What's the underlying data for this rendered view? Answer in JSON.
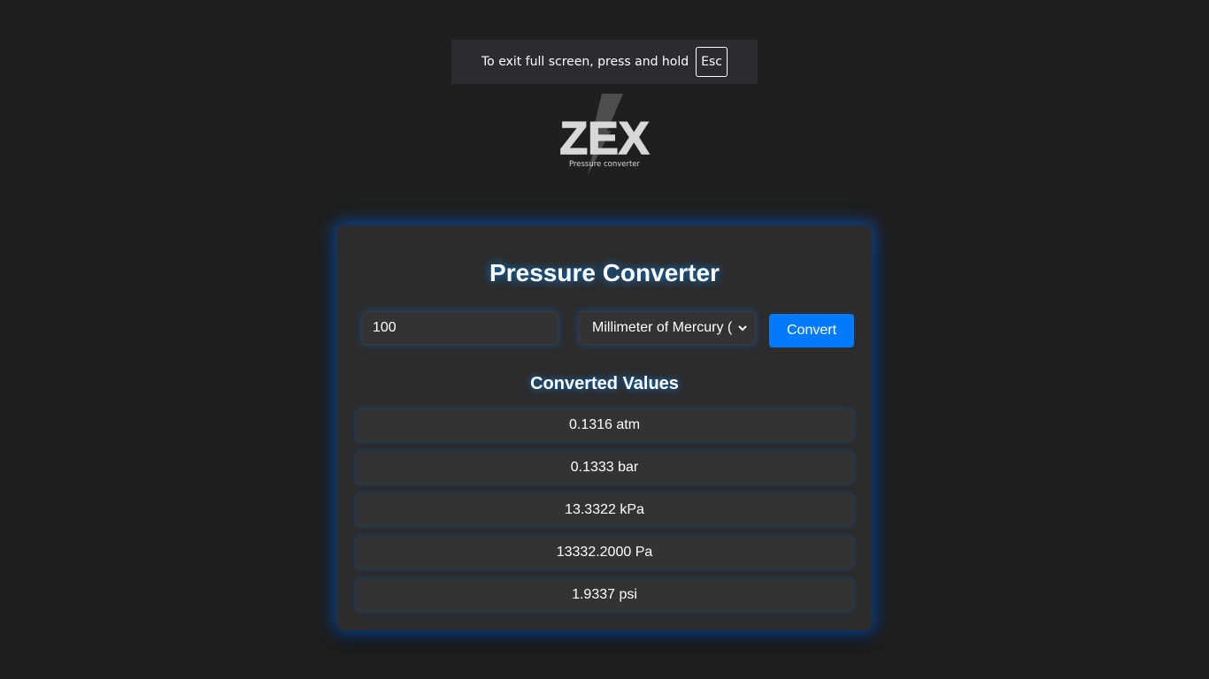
{
  "fullscreen_notice": {
    "text": "To exit full screen, press and hold",
    "key": "Esc"
  },
  "logo": {
    "wordmark": "ZEX",
    "tagline": "Pressure converter"
  },
  "converter": {
    "title": "Pressure Converter",
    "input_value": "100",
    "unit_selected": "Millimeter of Mercury (",
    "convert_label": "Convert",
    "results_title": "Converted Values",
    "results": [
      "0.1316 atm",
      "0.1333 bar",
      "13.3322 kPa",
      "13332.2000 Pa",
      "1.9337 psi"
    ]
  },
  "colors": {
    "background": "#1f1f1f",
    "card": "#2c2c2c",
    "accent": "#007bff",
    "glow": "#006eff"
  }
}
